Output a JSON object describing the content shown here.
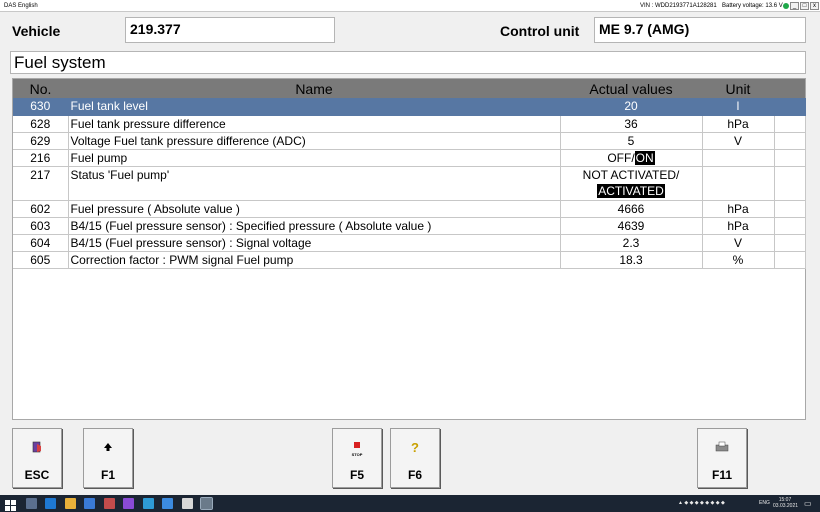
{
  "window": {
    "title": "DAS English",
    "vin": "VIN : WDD2193771A128281",
    "battery": "Battery voltage: 13.6 V",
    "minimize": "_",
    "restore": "□",
    "close": "x"
  },
  "header": {
    "vehicle_label": "Vehicle",
    "vehicle_value": "219.377",
    "control_unit_label": "Control unit",
    "control_unit_value": "ME 9.7 (AMG)"
  },
  "section_title": "Fuel system",
  "table": {
    "columns": [
      "No.",
      "Name",
      "Actual values",
      "Unit"
    ],
    "rows": [
      {
        "no": "630",
        "name": "Fuel tank level",
        "value": "20",
        "unit": "l"
      },
      {
        "no": "628",
        "name": "Fuel tank pressure difference",
        "value": "36",
        "unit": "hPa"
      },
      {
        "no": "629",
        "name": "Voltage Fuel tank pressure difference (ADC)",
        "value": "5",
        "unit": "V"
      },
      {
        "no": "216",
        "name": "Fuel pump",
        "value_a": "OFF/",
        "value_b": "ON",
        "unit": ""
      },
      {
        "no": "217",
        "name": "Status 'Fuel pump'",
        "value_a": "NOT ACTIVATED/",
        "value_b": "ACTIVATED",
        "unit": ""
      },
      {
        "no": "602",
        "name": "Fuel pressure ( Absolute value )",
        "value": "4666",
        "unit": "hPa"
      },
      {
        "no": "603",
        "name": "B4/15 (Fuel pressure sensor) : Specified pressure ( Absolute value )",
        "value": "4639",
        "unit": "hPa"
      },
      {
        "no": "604",
        "name": "B4/15 (Fuel pressure sensor) : Signal voltage",
        "value": "2.3",
        "unit": "V"
      },
      {
        "no": "605",
        "name": "Correction factor : PWM signal Fuel pump",
        "value": "18.3",
        "unit": "%"
      }
    ]
  },
  "function_keys": [
    {
      "label": "ESC",
      "icon": "exit-door-icon"
    },
    {
      "label": "F1",
      "icon": "arrow-up-icon"
    },
    {
      "label": "F5",
      "icon": "stop-sign-icon",
      "icon_text": "STOP"
    },
    {
      "label": "F6",
      "icon": "help-question-icon",
      "icon_text": "?"
    },
    {
      "label": "F11",
      "icon": "printer-icon"
    }
  ],
  "taskbar": {
    "language": "ENG",
    "time": "15:07",
    "date": "03.03.2021"
  },
  "colors": {
    "selected_row": "#5777a3",
    "header_row": "#7a7a7a",
    "taskbar": "#1b2533"
  }
}
